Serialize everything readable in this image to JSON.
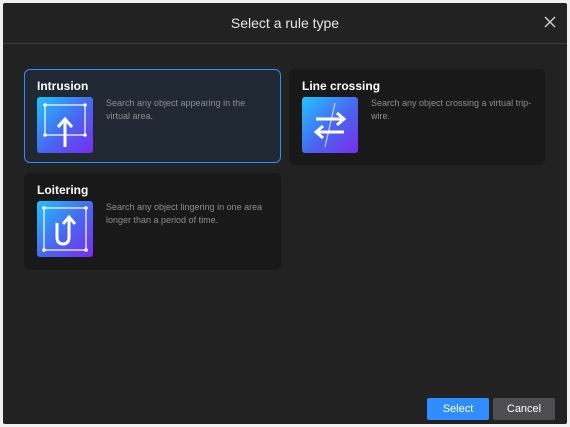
{
  "dialog": {
    "title": "Select a rule type",
    "close_icon": "close-icon"
  },
  "rules": [
    {
      "title": "Intrusion",
      "description": "Search any object appearing in the virtual area.",
      "icon": "intrusion-icon",
      "selected": true
    },
    {
      "title": "Line crossing",
      "description": "Search any object crossing a virtual trip-wire.",
      "icon": "line-crossing-icon",
      "selected": false
    },
    {
      "title": "Loitering",
      "description": "Search any object lingering in one area longer than a period of time.",
      "icon": "loitering-icon",
      "selected": false
    }
  ],
  "buttons": {
    "select_label": "Select",
    "cancel_label": "Cancel"
  },
  "colors": {
    "accent": "#2f8dff",
    "dialog_bg": "#222223",
    "card_bg": "#19191a",
    "icon_gradient_start": "#1fc4ff",
    "icon_gradient_end": "#7a2cf0"
  }
}
